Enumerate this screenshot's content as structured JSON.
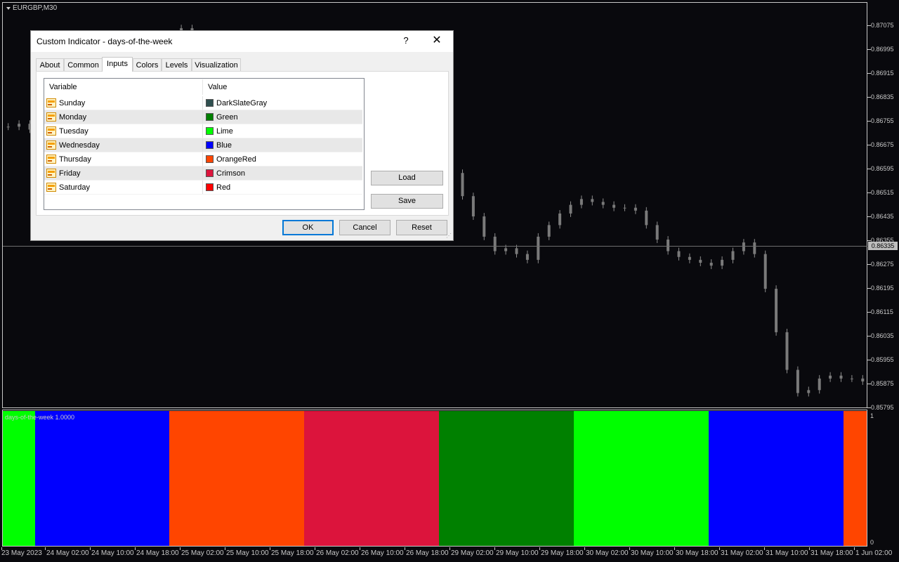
{
  "chart": {
    "symbol": "EURGBP,M30",
    "price_levels": [
      "0.87075",
      "0.86995",
      "0.86915",
      "0.86835",
      "0.86755",
      "0.86675",
      "0.86595",
      "0.86515",
      "0.86435",
      "0.86355",
      "0.86275",
      "0.86195",
      "0.86115",
      "0.86035",
      "0.85955",
      "0.85875",
      "0.85795"
    ],
    "current_price": "0.86335",
    "time_labels": [
      "23 May 2023",
      "24 May 02:00",
      "24 May 10:00",
      "24 May 18:00",
      "25 May 02:00",
      "25 May 10:00",
      "25 May 18:00",
      "26 May 02:00",
      "26 May 10:00",
      "26 May 18:00",
      "29 May 02:00",
      "29 May 10:00",
      "29 May 18:00",
      "30 May 02:00",
      "30 May 10:00",
      "30 May 18:00",
      "31 May 02:00",
      "31 May 10:00",
      "31 May 18:00",
      "1 Jun 02:00"
    ],
    "price_close_series": [
      0.8676,
      0.8677,
      0.8675,
      0.8672,
      0.867,
      0.8674,
      0.8678,
      0.868,
      0.8684,
      0.8689,
      0.8692,
      0.8696,
      0.8699,
      0.8702,
      0.8705,
      0.8708,
      0.871,
      0.8708,
      0.8704,
      0.8696,
      0.869,
      0.8686,
      0.8684,
      0.8687,
      0.869,
      0.8692,
      0.869,
      0.8686,
      0.8681,
      0.8676,
      0.8672,
      0.8669,
      0.8668,
      0.8667,
      0.8667,
      0.8668,
      0.8669,
      0.8671,
      0.867,
      0.8667,
      0.8665,
      0.866,
      0.8652,
      0.8645,
      0.8638,
      0.8633,
      0.8634,
      0.8632,
      0.863,
      0.8638,
      0.8642,
      0.8646,
      0.8649,
      0.8651,
      0.865,
      0.8649,
      0.8648,
      0.8648,
      0.8647,
      0.8642,
      0.8637,
      0.8633,
      0.8631,
      0.863,
      0.8629,
      0.8628,
      0.863,
      0.8633,
      0.8636,
      0.8632,
      0.862,
      0.8605,
      0.8592,
      0.8584,
      0.8585,
      0.8589,
      0.859,
      0.8589,
      0.8589,
      0.8588
    ],
    "indicator": {
      "label": "days-of-the-week 1.0000",
      "scale_top": "1",
      "scale_bottom": "0",
      "bands": [
        {
          "day": "Tuesday",
          "color": "#00ff00",
          "from": 0,
          "to": 0.037
        },
        {
          "day": "Wednesday",
          "color": "#0000ff",
          "from": 0.037,
          "to": 0.193
        },
        {
          "day": "Thursday",
          "color": "#ff4500",
          "from": 0.193,
          "to": 0.349
        },
        {
          "day": "Friday",
          "color": "#dc143c",
          "from": 0.349,
          "to": 0.505
        },
        {
          "day": "Monday",
          "color": "#008000",
          "from": 0.505,
          "to": 0.661
        },
        {
          "day": "Tuesday",
          "color": "#00ff00",
          "from": 0.661,
          "to": 0.817
        },
        {
          "day": "Wednesday",
          "color": "#0000ff",
          "from": 0.817,
          "to": 0.973
        },
        {
          "day": "Thursday",
          "color": "#ff4500",
          "from": 0.973,
          "to": 1
        }
      ]
    }
  },
  "dialog": {
    "title": "Custom Indicator - days-of-the-week",
    "help_glyph": "?",
    "close_glyph": "✕",
    "tabs": [
      "About",
      "Common",
      "Inputs",
      "Colors",
      "Levels",
      "Visualization"
    ],
    "active_tab": "Inputs",
    "columns": {
      "variable": "Variable",
      "value": "Value"
    },
    "inputs": [
      {
        "variable": "Sunday",
        "value": "DarkSlateGray",
        "color": "#2f4f4f"
      },
      {
        "variable": "Monday",
        "value": "Green",
        "color": "#008000"
      },
      {
        "variable": "Tuesday",
        "value": "Lime",
        "color": "#00ff00"
      },
      {
        "variable": "Wednesday",
        "value": "Blue",
        "color": "#0000ff"
      },
      {
        "variable": "Thursday",
        "value": "OrangeRed",
        "color": "#ff4500"
      },
      {
        "variable": "Friday",
        "value": "Crimson",
        "color": "#dc143c"
      },
      {
        "variable": "Saturday",
        "value": "Red",
        "color": "#ff0000"
      }
    ],
    "load_label": "Load",
    "save_label": "Save",
    "ok_label": "OK",
    "cancel_label": "Cancel",
    "reset_label": "Reset"
  }
}
